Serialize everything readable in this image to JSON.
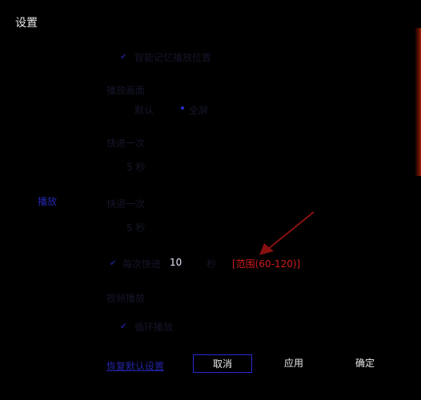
{
  "window": {
    "title": "设置"
  },
  "sidebar": {
    "active_item": "播放"
  },
  "options": {
    "top_checkbox_label": "智能记忆播放位置",
    "group1_label": "播放画面",
    "radio_a_label": "默认",
    "radio_b_label": "全屏",
    "group2_label": "快进一次",
    "group2_value": "5 秒",
    "group3_label": "快退一次",
    "group3_value": "5 秒",
    "seek_checkbox_label": "每次快进",
    "seek_value": "10",
    "seek_unit": "秒",
    "seek_note": "[范围(60-120)]",
    "group4_label": "视频播放",
    "bottom_checkbox_label": "循环播放"
  },
  "footer": {
    "reset_label": "恢复默认设置",
    "cancel_label": "取消",
    "apply_label": "应用",
    "ok_label": "确定"
  },
  "colors": {
    "background": "#000000",
    "accent_blue": "#2a2ad0",
    "annotation_red": "#d11c1c"
  }
}
